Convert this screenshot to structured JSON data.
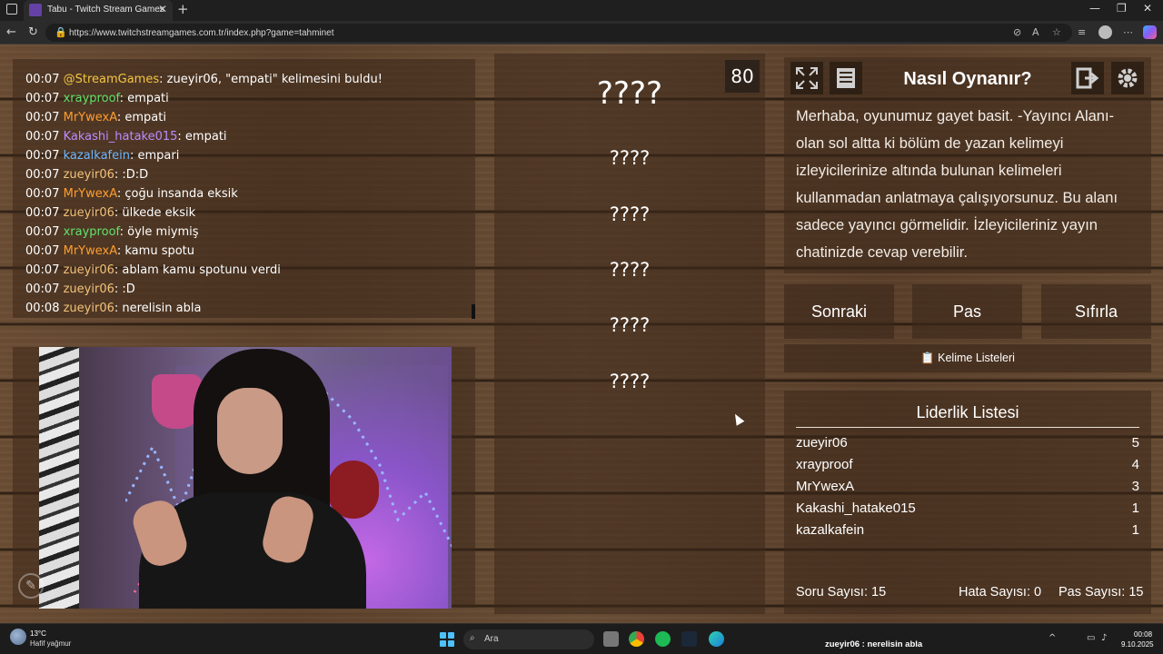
{
  "browser": {
    "tab_title": "Tabu - Twitch Stream Games",
    "url": "https://www.twitchstreamgames.com.tr/index.php?game=tahminet"
  },
  "chat": {
    "messages": [
      {
        "time": "00:07",
        "user": "@StreamGames",
        "text": ": zueyir06, \"empati\" kelimesini buldu!",
        "color": "#f4c542"
      },
      {
        "time": "00:07",
        "user": "xrayproof",
        "text": ": empati",
        "color": "#5fe36b"
      },
      {
        "time": "00:07",
        "user": "MrYwexA",
        "text": ": empati",
        "color": "#ff9d2f"
      },
      {
        "time": "00:07",
        "user": "Kakashi_hatake015",
        "text": ": empati",
        "color": "#b98cff"
      },
      {
        "time": "00:07",
        "user": "kazalkafein",
        "text": ": empari",
        "color": "#6fb8ff"
      },
      {
        "time": "00:07",
        "user": "zueyir06",
        "text": ": :D:D",
        "color": "#f3c27a"
      },
      {
        "time": "00:07",
        "user": "MrYwexA",
        "text": ": çoğu insanda eksik",
        "color": "#ff9d2f"
      },
      {
        "time": "00:07",
        "user": "zueyir06",
        "text": ": ülkede eksik",
        "color": "#f3c27a"
      },
      {
        "time": "00:07",
        "user": "xrayproof",
        "text": ": öyle miymiş",
        "color": "#5fe36b"
      },
      {
        "time": "00:07",
        "user": "MrYwexA",
        "text": ": kamu spotu",
        "color": "#ff9d2f"
      },
      {
        "time": "00:07",
        "user": "zueyir06",
        "text": ": ablam kamu spotunu verdi",
        "color": "#f3c27a"
      },
      {
        "time": "00:07",
        "user": "zueyir06",
        "text": ": :D",
        "color": "#f3c27a"
      },
      {
        "time": "00:08",
        "user": "zueyir06",
        "text": ": nerelisin abla",
        "color": "#f3c27a"
      }
    ]
  },
  "game": {
    "timer": "80",
    "main_word": "????",
    "taboo_words": [
      "????",
      "????",
      "????",
      "????",
      "????"
    ]
  },
  "howto": {
    "title": "Nasıl Oynanır?",
    "text": "Merhaba, oyunumuz gayet basit. -Yayıncı Alanı- olan sol altta ki bölüm de yazan kelimeyi izleyicilerinize altında bulunan kelimeleri kullanmadan anlatmaya çalışıyorsunuz. Bu alanı sadece yayıncı görmelidir. İzleyicileriniz yayın chatinizde cevap verebilir."
  },
  "controls": {
    "next": "Sonraki",
    "pass": "Pas",
    "reset": "Sıfırla",
    "word_lists": "Kelime Listeleri",
    "word_lists_icon": "📋"
  },
  "leaderboard": {
    "title": "Liderlik Listesi",
    "rows": [
      {
        "name": "zueyir06",
        "score": "5"
      },
      {
        "name": "xrayproof",
        "score": "4"
      },
      {
        "name": "MrYwexA",
        "score": "3"
      },
      {
        "name": "Kakashi_hatake015",
        "score": "1"
      },
      {
        "name": "kazalkafein",
        "score": "1"
      }
    ]
  },
  "stats": {
    "questions": "Soru Sayısı: 15",
    "errors": "Hata Sayısı: 0",
    "passes": "Pas Sayısı: 15"
  },
  "taskbar": {
    "temperature": "13°C",
    "weather": "Hafif yağmur",
    "search": "Ara",
    "notification": "zueyir06 : nerelisin abla",
    "time": "00:08",
    "date": "9.10.2025"
  },
  "icons": {
    "fullscreen": "fullscreen-icon",
    "notes": "notes-icon",
    "exit": "exit-icon",
    "settings": "gear-icon"
  }
}
